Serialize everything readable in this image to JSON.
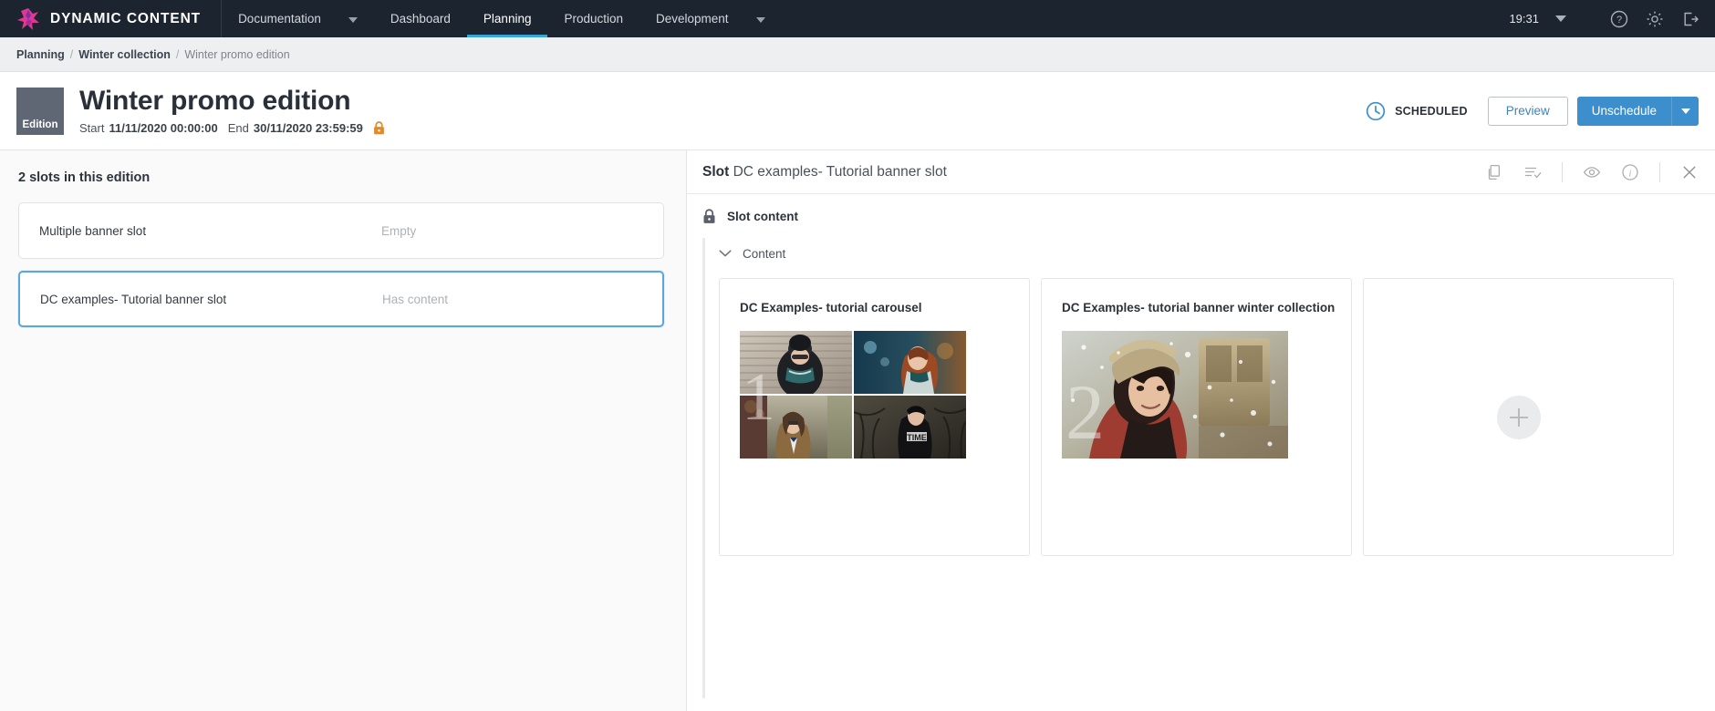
{
  "topnav": {
    "brand": "DYNAMIC CONTENT",
    "items": [
      {
        "label": "Documentation",
        "active": false,
        "caret": true
      },
      {
        "label": "Dashboard",
        "active": false,
        "caret": false
      },
      {
        "label": "Planning",
        "active": true,
        "caret": false
      },
      {
        "label": "Production",
        "active": false,
        "caret": false
      },
      {
        "label": "Development",
        "active": false,
        "caret": true
      }
    ],
    "time": "19:31",
    "icons": [
      "help-icon",
      "gear-icon",
      "logout-icon"
    ]
  },
  "breadcrumb": {
    "items": [
      "Planning",
      "Winter collection",
      "Winter promo edition"
    ],
    "separator": "/"
  },
  "header": {
    "badge": "Edition",
    "title": "Winter promo edition",
    "start_label": "Start",
    "start_value": "11/11/2020 00:00:00",
    "end_label": "End",
    "end_value": "30/11/2020 23:59:59",
    "status": "SCHEDULED",
    "preview_label": "Preview",
    "unschedule_label": "Unschedule",
    "accent_color": "#3d8ecc",
    "badge_color": "#5e6773",
    "lock_color": "#e08a2e"
  },
  "left_pane": {
    "title": "2 slots in this edition",
    "slots": [
      {
        "name": "Multiple banner slot",
        "status": "Empty",
        "selected": false
      },
      {
        "name": "DC examples- Tutorial banner slot",
        "status": "Has content",
        "selected": true
      }
    ]
  },
  "right_pane": {
    "header_prefix": "Slot",
    "header_name": "DC examples- Tutorial banner slot",
    "icons": [
      "copy-icon",
      "list-check-icon",
      "eye-icon",
      "info-icon",
      "close-icon"
    ],
    "slot_content_label": "Slot content",
    "content_toggle_label": "Content",
    "cards": [
      {
        "title": "DC Examples- tutorial carousel",
        "overlay_number": "1",
        "type": "grid"
      },
      {
        "title": "DC Examples- tutorial banner winter collection",
        "overlay_number": "2",
        "type": "single"
      },
      {
        "title": "",
        "type": "add"
      }
    ]
  }
}
